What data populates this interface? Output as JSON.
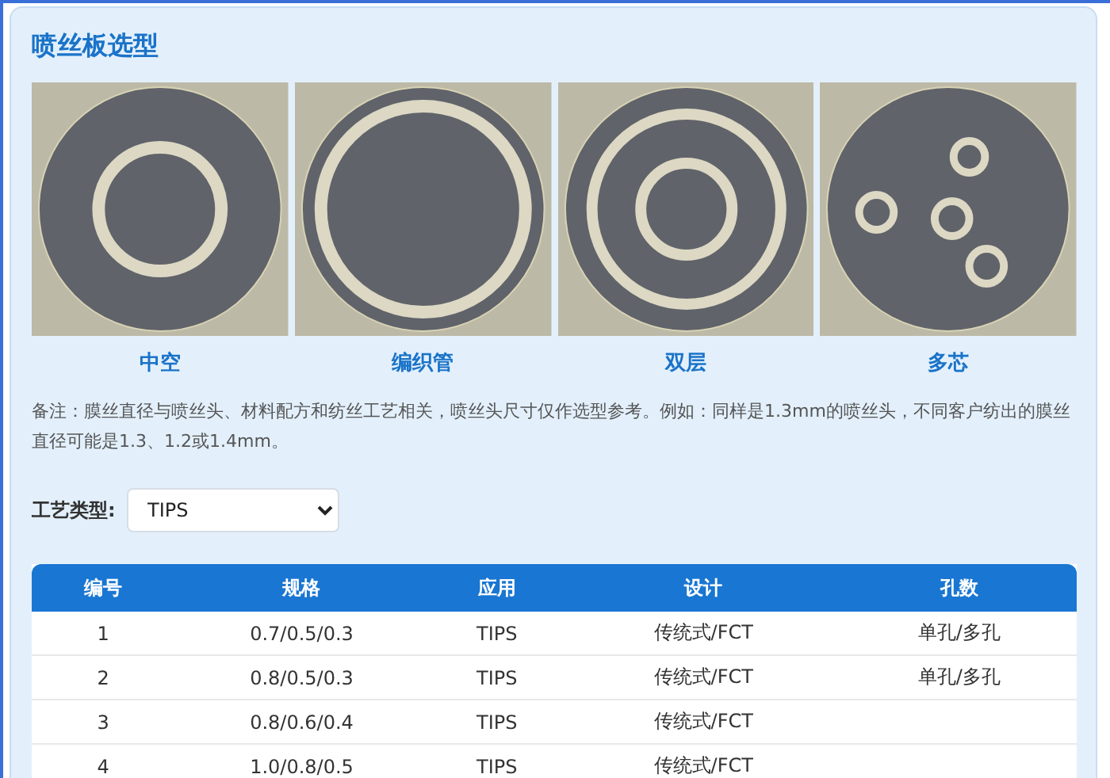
{
  "title": "喷丝板选型",
  "samples": [
    {
      "kind": "hollow",
      "label": "中空"
    },
    {
      "kind": "braided",
      "label": "编织管"
    },
    {
      "kind": "double",
      "label": "双层"
    },
    {
      "kind": "multi",
      "label": "多芯"
    }
  ],
  "note": "备注：膜丝直径与喷丝头、材料配方和纺丝工艺相关，喷丝头尺寸仅作选型参考。例如：同样是1.3mm的喷丝头，不同客户纺出的膜丝直径可能是1.3、1.2或1.4mm。",
  "process_type": {
    "label": "工艺类型:",
    "value": "TIPS"
  },
  "table": {
    "columns": [
      "编号",
      "规格",
      "应用",
      "设计",
      "孔数"
    ],
    "rows": [
      [
        "1",
        "0.7/0.5/0.3",
        "TIPS",
        "传统式/FCT",
        "单孔/多孔"
      ],
      [
        "2",
        "0.8/0.5/0.3",
        "TIPS",
        "传统式/FCT",
        "单孔/多孔"
      ],
      [
        "3",
        "0.8/0.6/0.4",
        "TIPS",
        "传统式/FCT"
      ],
      [
        "4",
        "1.0/0.8/0.5",
        "TIPS",
        "传统式/FCT"
      ]
    ]
  }
}
